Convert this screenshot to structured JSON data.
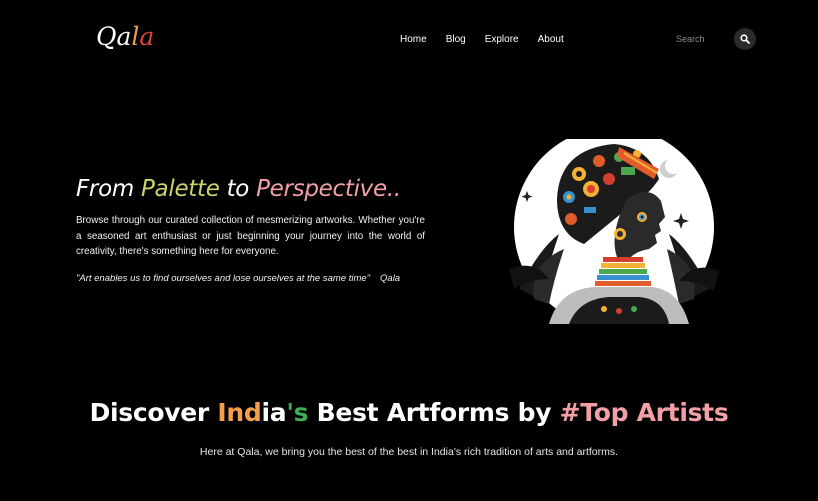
{
  "logo": {
    "letters": [
      "Q",
      "a",
      "l",
      "a"
    ],
    "colors": [
      "#ffffff",
      "#ffffff",
      "#e8a33a",
      "#d8453b"
    ]
  },
  "nav": {
    "items": [
      "Home",
      "Blog",
      "Explore",
      "About"
    ]
  },
  "search": {
    "placeholder": "Search",
    "icon": "search-icon"
  },
  "hero": {
    "title": {
      "parts": [
        "From ",
        "Palette",
        " to ",
        "Perspective.."
      ],
      "colors": [
        "#ffffff",
        "#c9d36a",
        "#ffffff",
        "#f2a0a6"
      ]
    },
    "description": "Browse through our curated collection of mesmerizing artworks. Whether you're a seasoned art enthusiast or just beginning your journey into the world of creativity, there's something here for everyone.",
    "quote": "\"Art enables us to find ourselves and lose ourselves at the same time\"",
    "quote_author": "Qala",
    "image_icon": "african-woman-portrait-illustration"
  },
  "discover": {
    "title_parts": [
      "Discover ",
      "Ind",
      "ia",
      "'s",
      " Best Artforms by ",
      "#Top Artists"
    ],
    "title_colors": [
      "#ffffff",
      "#f4a04a",
      "#ffffff",
      "#3fae5a",
      "#ffffff",
      "#f2a0a6"
    ],
    "subtitle": "Here at Qala, we bring you the best of the best in India's rich tradition of arts and artforms."
  }
}
